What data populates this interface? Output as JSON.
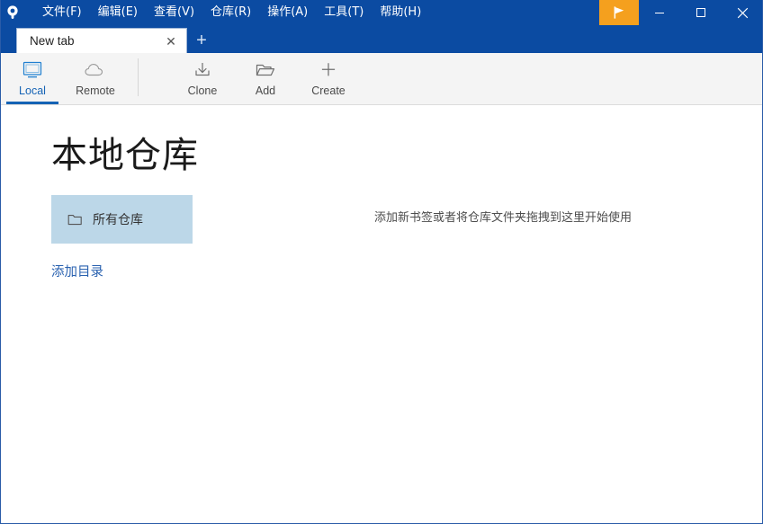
{
  "titlebar": {
    "logo_icon": "sourcetree-logo-icon",
    "menus": [
      {
        "label": "文件(F)",
        "name": "menu-file"
      },
      {
        "label": "编辑(E)",
        "name": "menu-edit"
      },
      {
        "label": "查看(V)",
        "name": "menu-view"
      },
      {
        "label": "仓库(R)",
        "name": "menu-repository"
      },
      {
        "label": "操作(A)",
        "name": "menu-actions"
      },
      {
        "label": "工具(T)",
        "name": "menu-tools"
      },
      {
        "label": "帮助(H)",
        "name": "menu-help"
      }
    ],
    "flag_button": {
      "icon": "flag-icon",
      "color": "#f5a01e"
    },
    "window_controls": {
      "minimize": "—",
      "maximize": "□",
      "close": "×"
    },
    "background_color": "#0b4ba2"
  },
  "tabs": {
    "items": [
      {
        "title": "New tab",
        "close_glyph": "✕",
        "active": true
      }
    ],
    "new_tab_glyph": "+"
  },
  "toolbar": {
    "left_group": [
      {
        "label": "Local",
        "icon": "monitor-icon",
        "active": true
      },
      {
        "label": "Remote",
        "icon": "cloud-icon",
        "active": false
      }
    ],
    "right_group": [
      {
        "label": "Clone",
        "icon": "download-icon"
      },
      {
        "label": "Add",
        "icon": "folder-open-icon"
      },
      {
        "label": "Create",
        "icon": "plus-icon"
      }
    ],
    "accent_color": "#1563b5"
  },
  "main": {
    "page_title": "本地仓库",
    "repo_items": [
      {
        "label": "所有仓库",
        "icon": "folder-icon",
        "selected": true
      }
    ],
    "add_directory_link": "添加目录",
    "drop_hint": "添加新书签或者将仓库文件夹拖拽到这里开始使用",
    "selection_color": "#bcd7e8",
    "link_color": "#2a62b0"
  }
}
